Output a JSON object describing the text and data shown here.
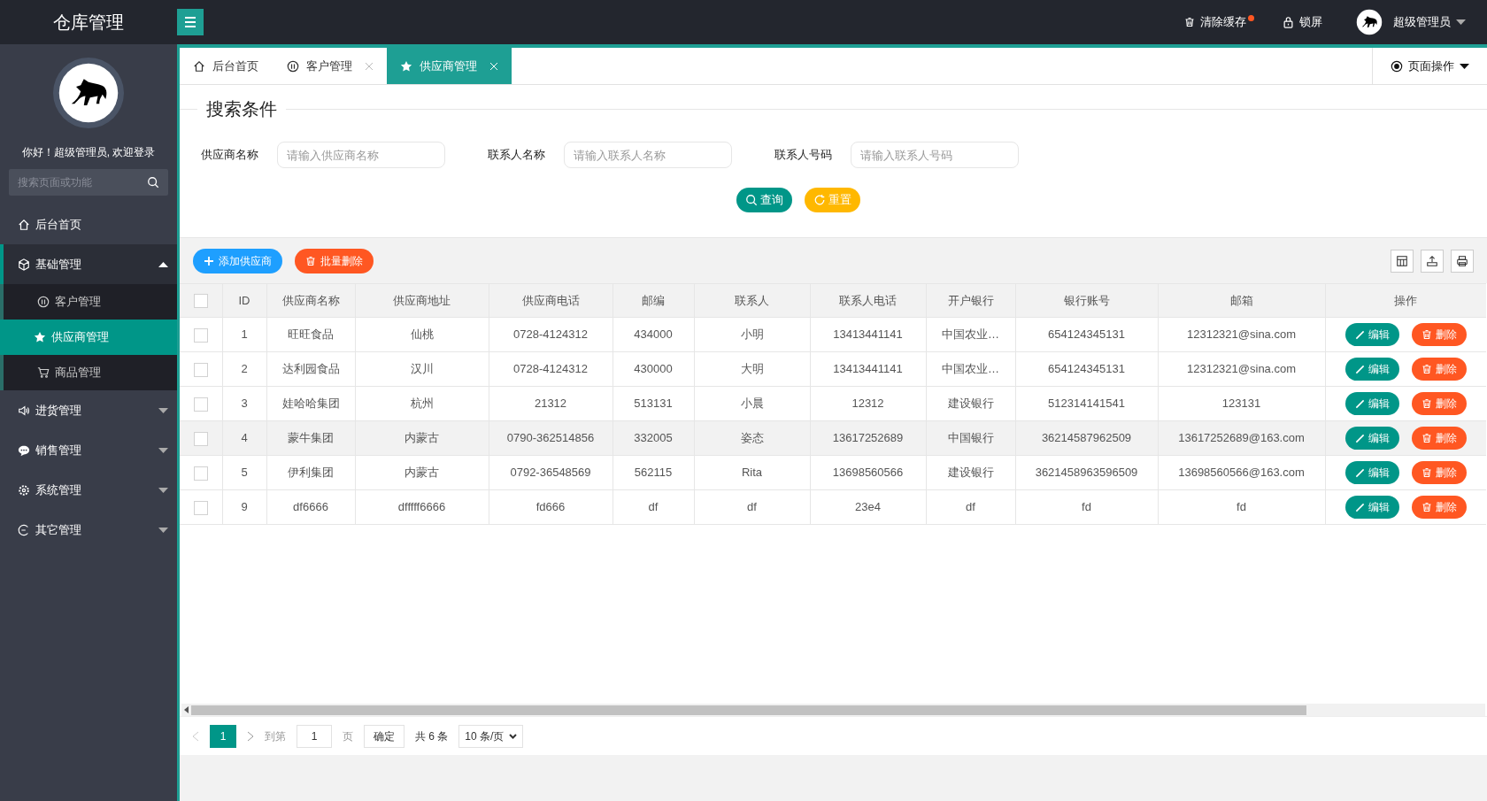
{
  "app_title": "仓库管理",
  "header": {
    "clear_cache": "清除缓存",
    "lock": "锁屏",
    "user": "超级管理员"
  },
  "sidebar": {
    "greeting": "你好！超级管理员, 欢迎登录",
    "search": {
      "placeholder": "搜索页面或功能"
    },
    "items": [
      {
        "label": "后台首页",
        "selected": false
      },
      {
        "label": "基础管理",
        "selected": false,
        "expanded": true,
        "children": [
          {
            "label": "客户管理",
            "selected": false
          },
          {
            "label": "供应商管理",
            "selected": true
          },
          {
            "label": "商品管理",
            "selected": false
          }
        ]
      },
      {
        "label": "进货管理",
        "selected": false,
        "expanded": false
      },
      {
        "label": "销售管理",
        "selected": false,
        "expanded": false
      },
      {
        "label": "系统管理",
        "selected": false,
        "expanded": false
      },
      {
        "label": "其它管理",
        "selected": false,
        "expanded": false
      }
    ]
  },
  "tabs": [
    {
      "label": "后台首页",
      "selected": false,
      "closable": false
    },
    {
      "label": "客户管理",
      "selected": false,
      "closable": true
    },
    {
      "label": "供应商管理",
      "selected": true,
      "closable": true
    }
  ],
  "page_ops": "页面操作",
  "search_panel": {
    "title": "搜索条件",
    "fields": [
      {
        "label": "供应商名称",
        "placeholder": "请输入供应商名称"
      },
      {
        "label": "联系人名称",
        "placeholder": "请输入联系人名称"
      },
      {
        "label": "联系人号码",
        "placeholder": "请输入联系人号码"
      }
    ],
    "buttons": [
      {
        "label": "查询",
        "kind": "search"
      },
      {
        "label": "重置",
        "kind": "reset"
      }
    ]
  },
  "toolbar": {
    "buttons": [
      {
        "label": "添加供应商",
        "kind": "add"
      },
      {
        "label": "批量删除",
        "kind": "delete"
      }
    ]
  },
  "table": {
    "select_all_checked": false,
    "columns": [
      "ID",
      "供应商名称",
      "供应商地址",
      "供应商电话",
      "邮编",
      "联系人",
      "联系人电话",
      "开户银行",
      "银行账号",
      "邮箱",
      "操作"
    ],
    "rows": [
      {
        "checked": false,
        "highlighted": false,
        "cells": [
          "1",
          "旺旺食品",
          "仙桃",
          "0728-4124312",
          "434000",
          "小明",
          "13413441141",
          "中国农业…",
          "654124345131",
          "12312321@sina.com"
        ],
        "actions": [
          "编辑",
          "删除"
        ]
      },
      {
        "checked": false,
        "highlighted": false,
        "cells": [
          "2",
          "达利园食品",
          "汉川",
          "0728-4124312",
          "430000",
          "大明",
          "13413441141",
          "中国农业…",
          "654124345131",
          "12312321@sina.com"
        ],
        "actions": [
          "编辑",
          "删除"
        ]
      },
      {
        "checked": false,
        "highlighted": false,
        "cells": [
          "3",
          "娃哈哈集团",
          "杭州",
          "21312",
          "513131",
          "小晨",
          "12312",
          "建设银行",
          "512314141541",
          "123131"
        ],
        "actions": [
          "编辑",
          "删除"
        ]
      },
      {
        "checked": false,
        "highlighted": true,
        "cells": [
          "4",
          "蒙牛集团",
          "内蒙古",
          "0790-362514856",
          "332005",
          "姿态",
          "13617252689",
          "中国银行",
          "36214587962509",
          "13617252689@163.com"
        ],
        "actions": [
          "编辑",
          "删除"
        ]
      },
      {
        "checked": false,
        "highlighted": false,
        "cells": [
          "5",
          "伊利集团",
          "内蒙古",
          "0792-36548569",
          "562115",
          "Rita",
          "13698560566",
          "建设银行",
          "3621458963596509",
          "13698560566@163.com"
        ],
        "actions": [
          "编辑",
          "删除"
        ]
      },
      {
        "checked": false,
        "highlighted": false,
        "cells": [
          "9",
          "df6666",
          "dfffff6666",
          "fd666",
          "df",
          "df",
          "23e4",
          "df",
          "fd",
          "fd"
        ],
        "actions": [
          "编辑",
          "删除"
        ]
      }
    ]
  },
  "pagination": {
    "current": "1",
    "goto_label": "到第",
    "goto_value": "1",
    "page_label": "页",
    "confirm": "确定",
    "total": "共 6 条",
    "page_size": "10 条/页"
  }
}
